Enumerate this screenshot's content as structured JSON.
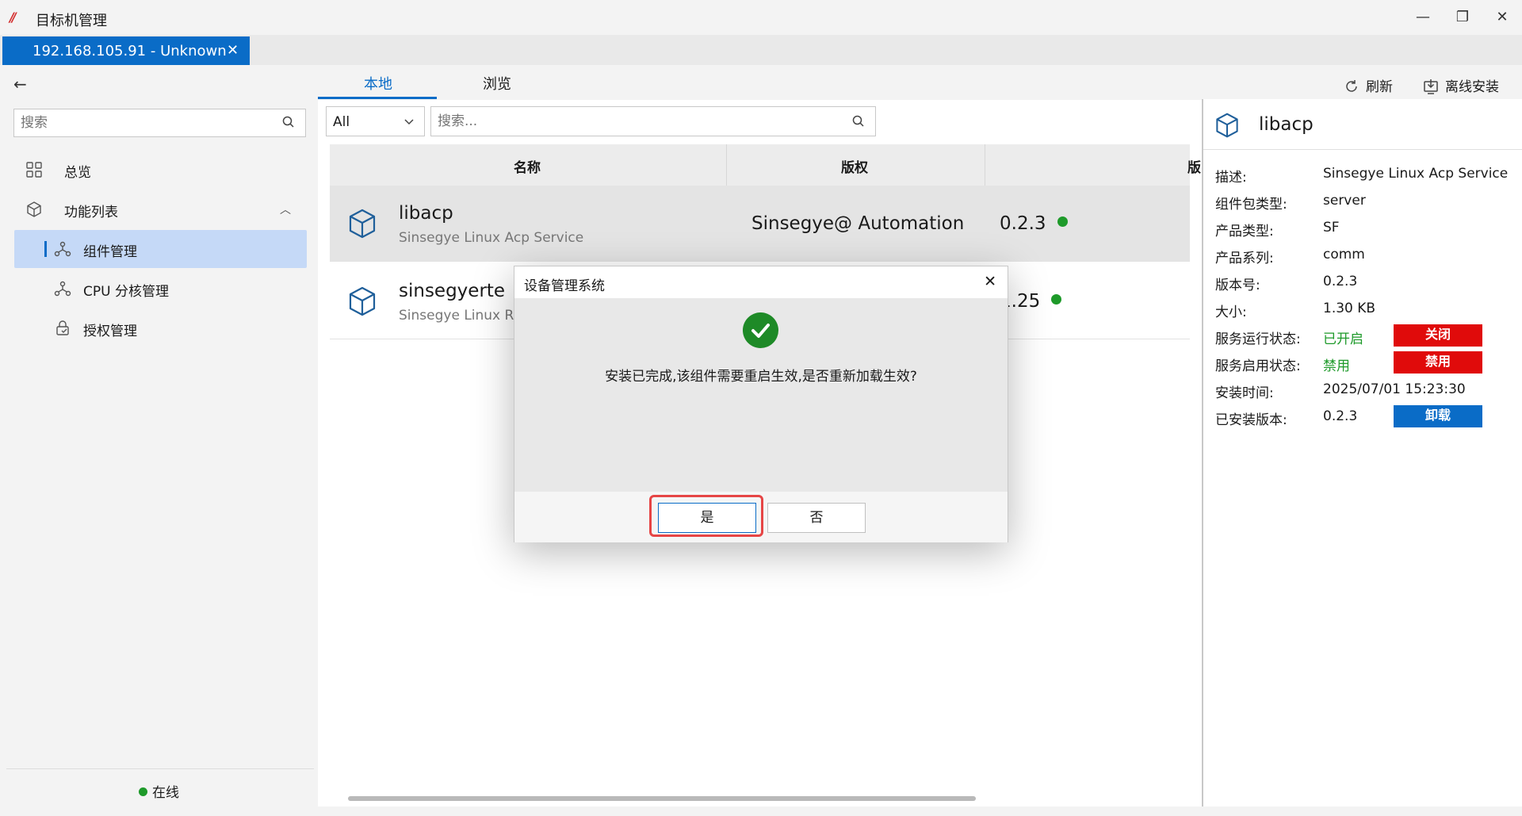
{
  "app": {
    "title": "目标机管理",
    "logo_glyph": "//"
  },
  "window_controls": {
    "minimize": "—",
    "restore": "❐",
    "close": "✕"
  },
  "host_tab": {
    "label": "192.168.105.91  -  Unknown",
    "close": "✕"
  },
  "sidebar": {
    "back": "←",
    "search_placeholder": "搜索",
    "items": [
      {
        "label": "总览"
      },
      {
        "label": "功能列表"
      },
      {
        "label": "组件管理"
      },
      {
        "label": "CPU  分核管理"
      },
      {
        "label": "授权管理"
      }
    ],
    "status": "在线"
  },
  "main": {
    "tabs": [
      {
        "label": "本地"
      },
      {
        "label": "浏览"
      }
    ],
    "filter_value": "All",
    "search_placeholder": "搜索...",
    "refresh_label": "刷新",
    "offline_install_label": "离线安装",
    "columns": [
      "名称",
      "版权",
      "版"
    ],
    "rows": [
      {
        "name": "libacp",
        "desc": "Sinsegye  Linux  Acp  Service",
        "copyright": "Sinsegye@  Automation",
        "version": "0.2.3"
      },
      {
        "name": "sinsegyerte",
        "desc": "Sinsegye  Linux  R",
        "copyright": "",
        "version": "1.25"
      }
    ]
  },
  "detail": {
    "title": "libacp",
    "fields": [
      {
        "key": "描述:",
        "value": "Sinsegye  Linux  Acp  Service"
      },
      {
        "key": "组件包类型:",
        "value": "server"
      },
      {
        "key": "产品类型:",
        "value": "SF"
      },
      {
        "key": "产品系列:",
        "value": "comm"
      },
      {
        "key": "版本号:",
        "value": "0.2.3"
      },
      {
        "key": "大小:",
        "value": "1.30  KB"
      },
      {
        "key": "服务运行状态:",
        "value": "已开启",
        "button": "关闭"
      },
      {
        "key": "服务启用状态:",
        "value": "禁用",
        "button": "禁用"
      },
      {
        "key": "安装时间:",
        "value": "2025/07/01  15:23:30"
      },
      {
        "key": "已安装版本:",
        "value": "0.2.3",
        "button": "卸载"
      }
    ]
  },
  "modal": {
    "title": "设备管理系统",
    "close": "✕",
    "message": "安装已完成,该组件需要重启生效,是否重新加载生效?",
    "yes": "是",
    "no": "否"
  },
  "colors": {
    "accent": "#0a6cc7",
    "danger": "#e00b0b",
    "success": "#1e9a2a"
  }
}
